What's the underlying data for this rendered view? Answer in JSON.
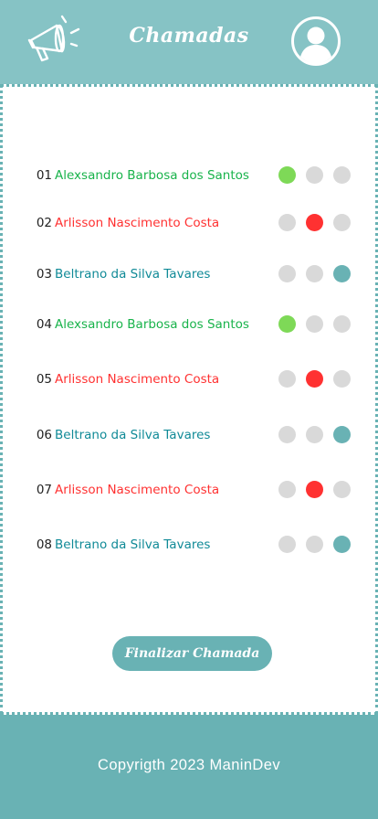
{
  "header": {
    "title": "Chamadas",
    "icons": {
      "left": "megaphone-icon",
      "right": "user-profile-icon"
    }
  },
  "colors": {
    "header_bg": "#86c3c5",
    "accent": "#69b2b4",
    "present": "#7ed957",
    "absent": "#ff3131",
    "excused": "#69b2b4",
    "inactive": "#d9d9d9",
    "name_green": "#19b34b",
    "name_red": "#ff3131",
    "name_teal": "#108a97"
  },
  "students": [
    {
      "number": "01",
      "name": "Alexsandro Barbosa dos Santos",
      "name_color": "green",
      "status": 0
    },
    {
      "number": "02",
      "name": "Arlisson Nascimento Costa",
      "name_color": "red",
      "status": 1
    },
    {
      "number": "03",
      "name": "Beltrano da Silva Tavares",
      "name_color": "teal",
      "status": 2
    },
    {
      "number": "04",
      "name": "Alexsandro Barbosa dos Santos",
      "name_color": "green",
      "status": 0
    },
    {
      "number": "05",
      "name": "Arlisson Nascimento Costa",
      "name_color": "red",
      "status": 1
    },
    {
      "number": "06",
      "name": "Beltrano da Silva Tavares",
      "name_color": "teal",
      "status": 2
    },
    {
      "number": "07",
      "name": "Arlisson Nascimento Costa",
      "name_color": "red",
      "status": 1
    },
    {
      "number": "08",
      "name": "Beltrano da Silva Tavares",
      "name_color": "teal",
      "status": 2
    }
  ],
  "actions": {
    "finish_label": "Finalizar Chamada"
  },
  "footer": {
    "copyright": "Copyrigth 2023 ManinDev"
  }
}
